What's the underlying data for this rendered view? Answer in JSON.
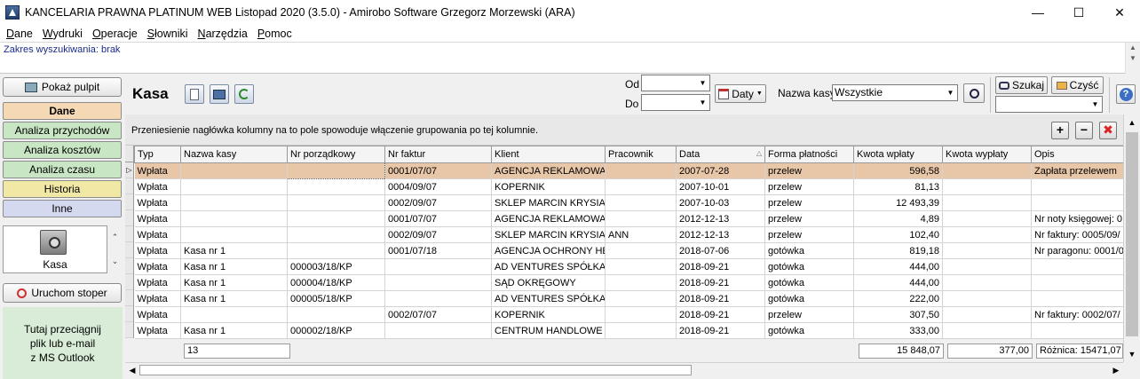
{
  "window": {
    "title": "KANCELARIA PRAWNA PLATINUM WEB Listopad 2020 (3.5.0)  -  Amirobo Software Grzegorz Morzewski  (ARA)"
  },
  "menu": [
    {
      "label": "Dane",
      "u": "D",
      "rest": "ane"
    },
    {
      "label": "Wydruki",
      "u": "W",
      "rest": "ydruki"
    },
    {
      "label": "Operacje",
      "u": "O",
      "rest": "peracje"
    },
    {
      "label": "Słowniki",
      "u": "S",
      "rest": "łowniki"
    },
    {
      "label": "Narzędzia",
      "u": "N",
      "rest": "arzędzia"
    },
    {
      "label": "Pomoc",
      "u": "P",
      "rest": "omoc"
    }
  ],
  "search_range": "Zakres wyszukiwania: brak",
  "left": {
    "show_desktop": "Pokaż pulpit",
    "nav": [
      {
        "label": "Dane",
        "bg": "#f5d9b5",
        "bold": true
      },
      {
        "label": "Analiza przychodów",
        "bg": "#c9e6c4"
      },
      {
        "label": "Analiza kosztów",
        "bg": "#c9e6c4"
      },
      {
        "label": "Analiza czasu",
        "bg": "#c9e6c4"
      },
      {
        "label": "Historia",
        "bg": "#f1e8a6"
      },
      {
        "label": "Inne",
        "bg": "#d5d9ef"
      }
    ],
    "module": "Kasa",
    "stopwatch": "Uruchom stoper",
    "drop_zone": "Tutaj przeciągnij\nplik lub e-mail\nz MS Outlook"
  },
  "header": {
    "title": "Kasa",
    "from_label": "Od",
    "to_label": "Do",
    "dates_button": "Daty",
    "cash_label": "Nazwa kasy",
    "cash_value": "Wszystkie",
    "search_button": "Szukaj",
    "clear_button": "Czyść"
  },
  "grid": {
    "group_hint": "Przeniesienie nagłówka kolumny na to pole spowoduje włączenie grupowania po tej kolumnie.",
    "columns": [
      "Typ",
      "Nazwa kasy",
      "Nr porządkowy",
      "Nr faktur",
      "Klient",
      "Pracownik",
      "Data",
      "Forma płatności",
      "Kwota wpłaty",
      "Kwota wypłaty",
      "Opis"
    ],
    "rows": [
      [
        "Wpłata",
        "",
        "",
        "0001/07/07",
        "AGENCJA REKLAMOWA",
        "",
        "2007-07-28",
        "przelew",
        "596,58",
        "",
        "Zapłata przelewem"
      ],
      [
        "Wpłata",
        "",
        "",
        "0004/09/07",
        "KOPERNIK",
        "",
        "2007-10-01",
        "przelew",
        "81,13",
        "",
        ""
      ],
      [
        "Wpłata",
        "",
        "",
        "0002/09/07",
        "SKLEP MARCIN KRYSIAK",
        "",
        "2007-10-03",
        "przelew",
        "12 493,39",
        "",
        ""
      ],
      [
        "Wpłata",
        "",
        "",
        "0001/07/07",
        "AGENCJA REKLAMOWA",
        "",
        "2012-12-13",
        "przelew",
        "4,89",
        "",
        "Nr noty księgowej: 0"
      ],
      [
        "Wpłata",
        "",
        "",
        "0002/09/07",
        "SKLEP MARCIN KRYSIAK",
        "ANN",
        "2012-12-13",
        "przelew",
        "102,40",
        "",
        "Nr faktury: 0005/09/"
      ],
      [
        "Wpłata",
        "Kasa nr 1",
        "",
        "0001/07/18",
        "AGENCJA OCHRONY HE",
        "",
        "2018-07-06",
        "gotówka",
        "819,18",
        "",
        "Nr paragonu: 0001/0"
      ],
      [
        "Wpłata",
        "Kasa nr 1",
        "000003/18/KP",
        "",
        "AD VENTURES SPÓŁKA",
        "",
        "2018-09-21",
        "gotówka",
        "444,00",
        "",
        ""
      ],
      [
        "Wpłata",
        "Kasa nr 1",
        "000004/18/KP",
        "",
        "SĄD OKRĘGOWY",
        "",
        "2018-09-21",
        "gotówka",
        "444,00",
        "",
        ""
      ],
      [
        "Wpłata",
        "Kasa nr 1",
        "000005/18/KP",
        "",
        "AD VENTURES SPÓŁKA",
        "",
        "2018-09-21",
        "gotówka",
        "222,00",
        "",
        ""
      ],
      [
        "Wpłata",
        "",
        "",
        "0002/07/07",
        "KOPERNIK",
        "",
        "2018-09-21",
        "przelew",
        "307,50",
        "",
        "Nr faktury: 0002/07/"
      ],
      [
        "Wpłata",
        "Kasa nr 1",
        "000002/18/KP",
        "",
        "CENTRUM HANDLOWE",
        "",
        "2018-09-21",
        "gotówka",
        "333,00",
        "",
        ""
      ]
    ],
    "footer": {
      "count": "13",
      "sum_in": "15 848,07",
      "sum_out": "377,00",
      "diff": "Różnica: 15471,07"
    }
  }
}
